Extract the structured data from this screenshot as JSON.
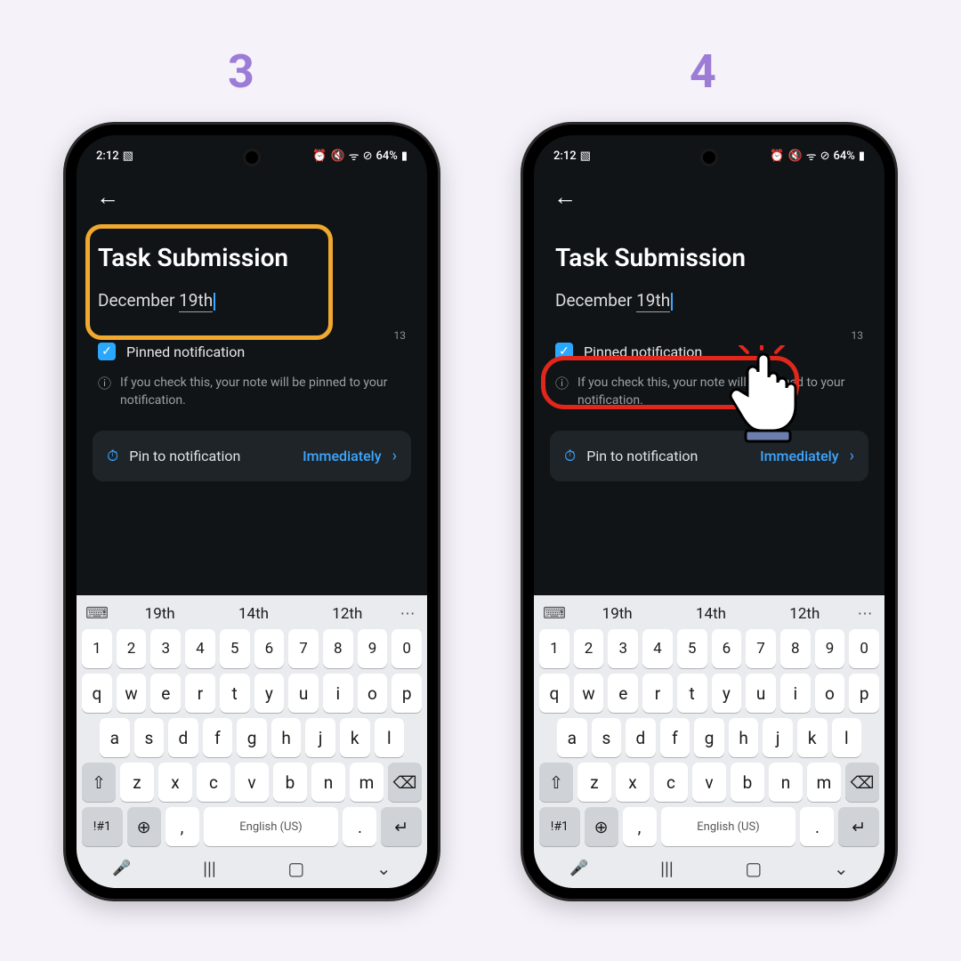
{
  "steps": {
    "left": "3",
    "right": "4"
  },
  "status": {
    "time": "2:12",
    "battery": "64%"
  },
  "note": {
    "title": "Task Submission",
    "body_prefix": "December ",
    "body_underlined": "19th",
    "char_count": "13"
  },
  "pinned": {
    "checkbox_label": "Pinned notification",
    "info_text": "If you check this, your note will be pinned to your notification."
  },
  "pin_card": {
    "label": "Pin to notification",
    "value": "Immediately"
  },
  "suggestions": {
    "w1": "19th",
    "w2": "14th",
    "w3": "12th"
  },
  "keyboard": {
    "row_num": [
      "1",
      "2",
      "3",
      "4",
      "5",
      "6",
      "7",
      "8",
      "9",
      "0"
    ],
    "row1": [
      "q",
      "w",
      "e",
      "r",
      "t",
      "y",
      "u",
      "i",
      "o",
      "p"
    ],
    "row2": [
      "a",
      "s",
      "d",
      "f",
      "g",
      "h",
      "j",
      "k",
      "l"
    ],
    "row3": [
      "z",
      "x",
      "c",
      "v",
      "b",
      "n",
      "m"
    ],
    "sym": "!#1",
    "lang": "English (US)",
    "comma": ",",
    "period": "."
  }
}
